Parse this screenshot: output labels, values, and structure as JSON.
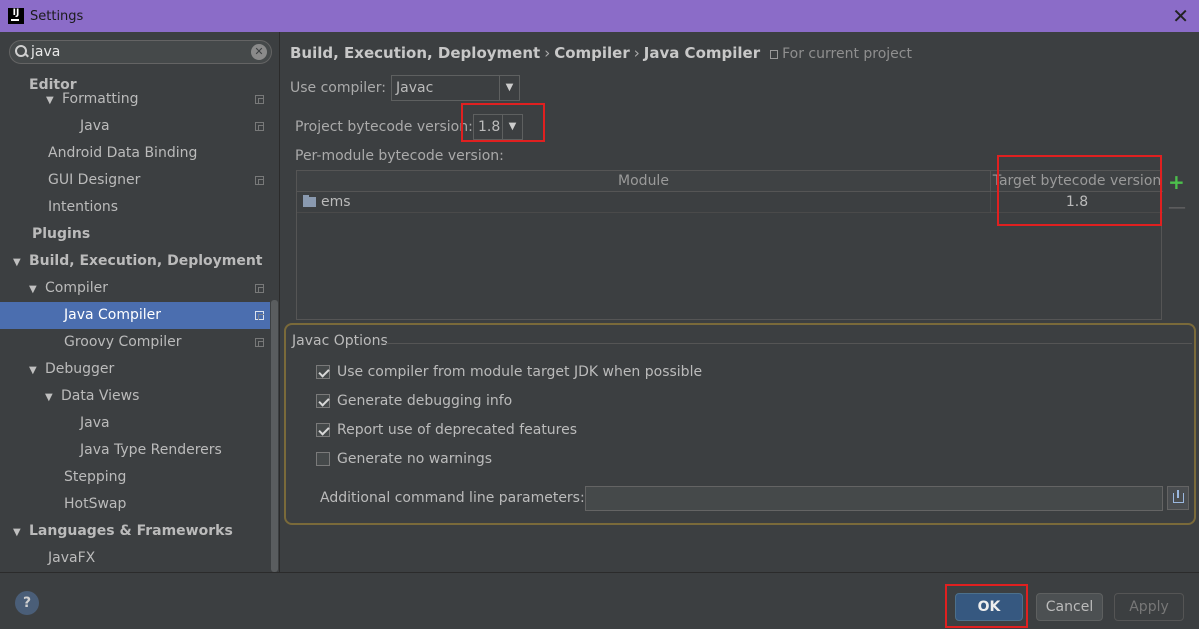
{
  "window": {
    "title": "Settings",
    "close_glyph": "✕"
  },
  "search": {
    "value": "java",
    "clear_glyph": "✕"
  },
  "sidebar": {
    "items": [
      {
        "label": "Editor"
      },
      {
        "label": "Formatting"
      },
      {
        "label": "Java"
      },
      {
        "label": "Android Data Binding"
      },
      {
        "label": "GUI Designer"
      },
      {
        "label": "Intentions"
      },
      {
        "label": "Plugins"
      },
      {
        "label": "Build, Execution, Deployment"
      },
      {
        "label": "Compiler"
      },
      {
        "label": "Java Compiler"
      },
      {
        "label": "Groovy Compiler"
      },
      {
        "label": "Debugger"
      },
      {
        "label": "Data Views"
      },
      {
        "label": "Java"
      },
      {
        "label": "Java Type Renderers"
      },
      {
        "label": "Stepping"
      },
      {
        "label": "HotSwap"
      },
      {
        "label": "Languages & Frameworks"
      },
      {
        "label": "JavaFX"
      }
    ]
  },
  "breadcrumb": {
    "parts": [
      "Build, Execution, Deployment",
      "Compiler",
      "Java Compiler"
    ],
    "separator": "›",
    "scope": "For current project"
  },
  "compiler": {
    "use_label": "Use compiler:",
    "use_value": "Javac",
    "bytecode_label": "Project bytecode version:",
    "bytecode_value": "1.8",
    "per_module_label": "Per-module bytecode version:"
  },
  "module_table": {
    "headers": [
      "Module",
      "Target bytecode version"
    ],
    "rows": [
      {
        "module": "ems",
        "version": "1.8"
      }
    ]
  },
  "javac_options": {
    "title": "Javac Options",
    "options": [
      {
        "label": "Use compiler from module target JDK when possible",
        "checked": true
      },
      {
        "label": "Generate debugging info",
        "checked": true
      },
      {
        "label": "Report use of deprecated features",
        "checked": true
      },
      {
        "label": "Generate no warnings",
        "checked": false
      }
    ],
    "params_label": "Additional command line parameters:",
    "params_value": ""
  },
  "footer": {
    "help": "?",
    "ok": "OK",
    "cancel": "Cancel",
    "apply": "Apply"
  },
  "colors": {
    "accent": "#4b6eaf",
    "titlebar": "#8b6cc8",
    "highlight": "#e02020"
  },
  "table_buttons": {
    "add": "+",
    "remove": "—"
  },
  "dropdown_glyph": "▼",
  "tree_glyphs": {
    "expanded": "▼"
  }
}
